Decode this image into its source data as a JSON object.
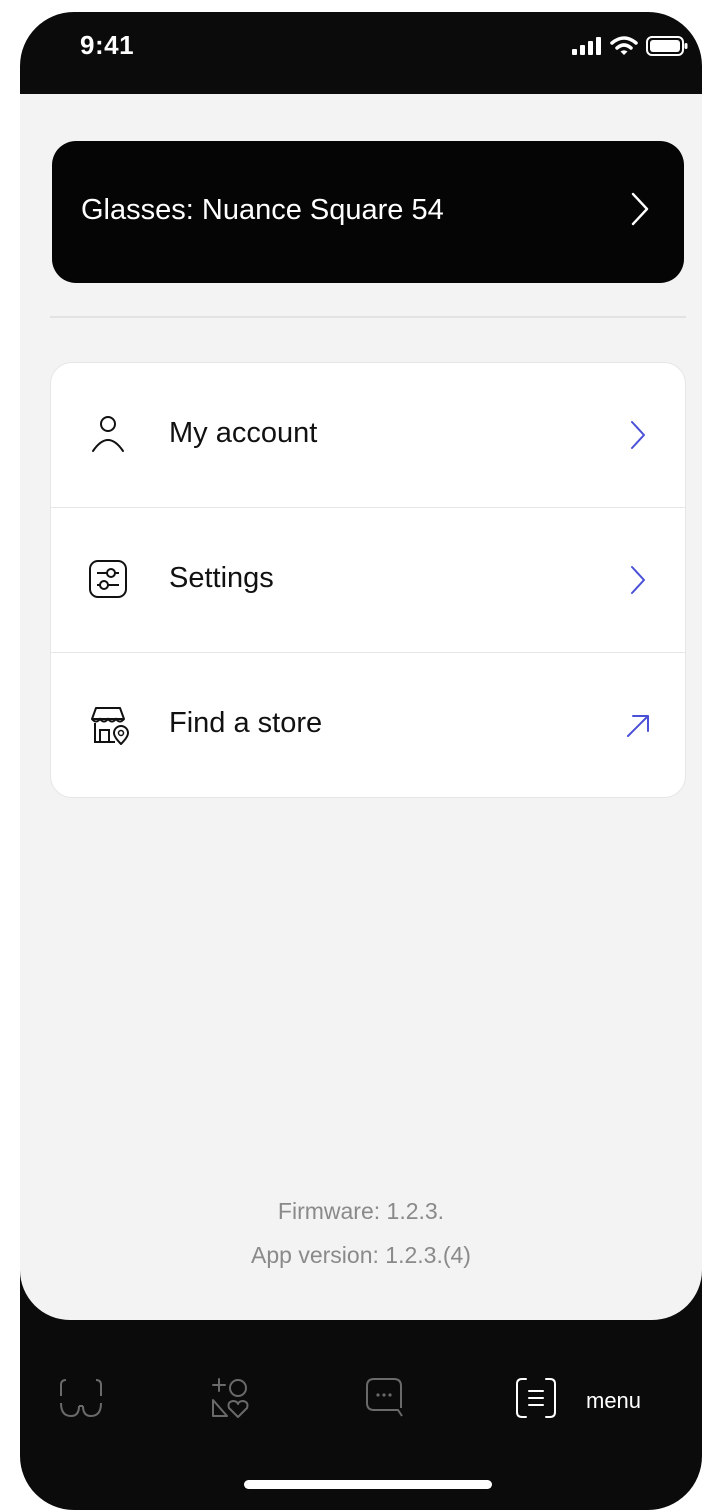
{
  "status_bar": {
    "time": "9:41"
  },
  "glasses": {
    "label": "Glasses: Nuance Square 54"
  },
  "menu_items": [
    {
      "label": "My account",
      "icon": "person-icon",
      "action": "chevron-right-icon"
    },
    {
      "label": "Settings",
      "icon": "sliders-icon",
      "action": "chevron-right-icon"
    },
    {
      "label": "Find a store",
      "icon": "store-location-icon",
      "action": "external-link-arrow-icon"
    }
  ],
  "footer": {
    "firmware": "Firmware: 1.2.3.",
    "app_version": "App version: 1.2.3.(4)"
  },
  "tabbar": {
    "tabs": [
      "glasses-icon",
      "add-favorite-icon",
      "chat-icon",
      "menu-icon"
    ],
    "active_label": "menu"
  },
  "colors": {
    "accent": "#4a50d8",
    "background": "#f3f3f3",
    "dark": "#0b0b0b"
  }
}
